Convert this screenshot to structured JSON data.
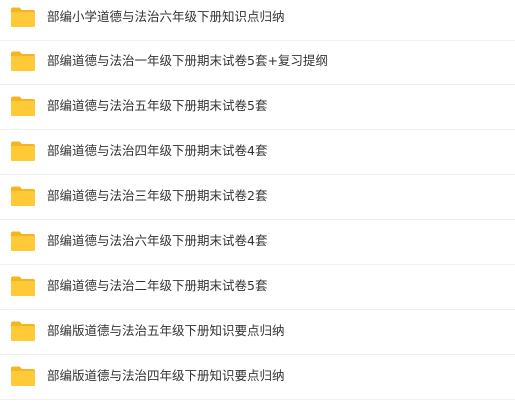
{
  "file_list": {
    "folder_icon": "folder-icon",
    "folder_color": "#FFC937",
    "folder_tab_color": "#F5B51F",
    "items": [
      {
        "name": "部编小学道德与法治六年级下册知识点归纳"
      },
      {
        "name": "部编道德与法治一年级下册期末试卷5套+复习提纲"
      },
      {
        "name": "部编道德与法治五年级下册期末试卷5套"
      },
      {
        "name": "部编道德与法治四年级下册期末试卷4套"
      },
      {
        "name": "部编道德与法治三年级下册期末试卷2套"
      },
      {
        "name": "部编道德与法治六年级下册期末试卷4套"
      },
      {
        "name": "部编道德与法治二年级下册期末试卷5套"
      },
      {
        "name": "部编版道德与法治五年级下册知识要点归纳"
      },
      {
        "name": "部编版道德与法治四年级下册知识要点归纳"
      }
    ]
  }
}
